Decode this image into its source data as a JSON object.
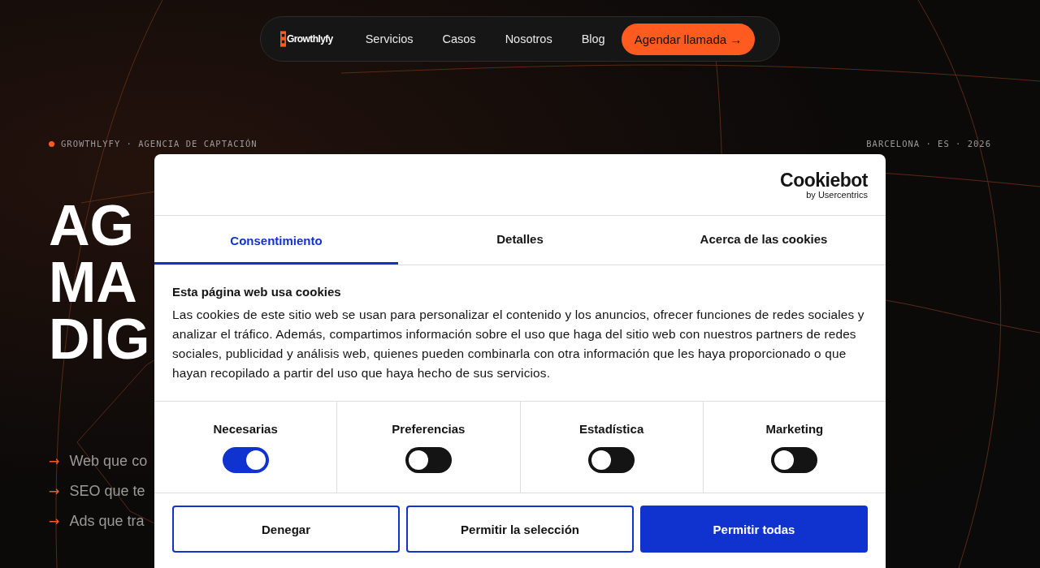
{
  "nav": {
    "logo": "Growthlyfy",
    "links": [
      {
        "label": "Servicios"
      },
      {
        "label": "Casos"
      },
      {
        "label": "Nosotros"
      },
      {
        "label": "Blog"
      }
    ],
    "cta": "Agendar llamada →"
  },
  "hero": {
    "eyebrow_left": "GROWTHLYFY · AGENCIA DE CAPTACIÓN",
    "eyebrow_right": "BARCELONA · ES · 2026",
    "title_lines": [
      "AG",
      "MA",
      "DIG"
    ],
    "bullets": [
      {
        "arrow": "→",
        "text": "Web que co"
      },
      {
        "arrow": "→",
        "text": "SEO que te"
      },
      {
        "arrow": "→",
        "text": "Ads que tra"
      }
    ]
  },
  "cookie_dialog": {
    "brand": "Cookiebot",
    "brand_sub": "by Usercentrics",
    "tabs": [
      {
        "label": "Consentimiento",
        "selected": true
      },
      {
        "label": "Detalles",
        "selected": false
      },
      {
        "label": "Acerca de las cookies",
        "selected": false
      }
    ],
    "heading": "Esta página web usa cookies",
    "body": "Las cookies de este sitio web se usan para personalizar el contenido y los anuncios, ofrecer funciones de redes sociales y analizar el tráfico. Además, compartimos información sobre el uso que haga del sitio web con nuestros partners de redes sociales, publicidad y análisis web, quienes pueden combinarla con otra información que les haya proporcionado o que hayan recopilado a partir del uso que haya hecho de sus servicios.",
    "categories": [
      {
        "label": "Necesarias",
        "on": true
      },
      {
        "label": "Preferencias",
        "on": false
      },
      {
        "label": "Estadística",
        "on": false
      },
      {
        "label": "Marketing",
        "on": false
      }
    ],
    "buttons": [
      {
        "label": "Denegar",
        "kind": "outline"
      },
      {
        "label": "Permitir la selección",
        "kind": "outline"
      },
      {
        "label": "Permitir todas",
        "kind": "primary"
      }
    ]
  }
}
